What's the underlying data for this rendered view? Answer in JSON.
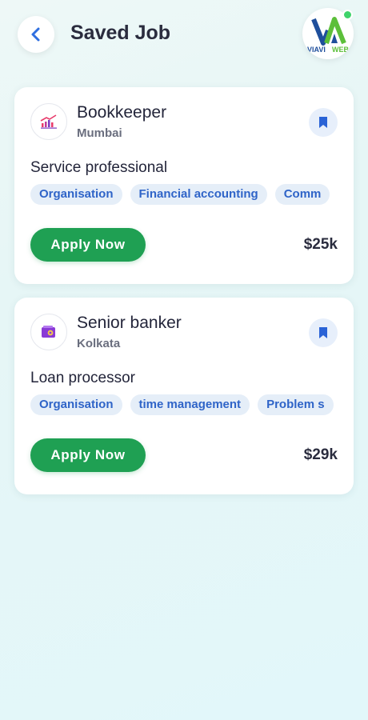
{
  "header": {
    "title": "Saved Job",
    "back_icon": "chevron-left-icon",
    "logo_text": {
      "part1": "VIAVI",
      "part2": "WEB"
    }
  },
  "colors": {
    "accent_blue": "#2f64c8",
    "apply_green": "#1fa053",
    "tag_bg": "#e5eef8"
  },
  "jobs": [
    {
      "title": "Bookkeeper",
      "location": "Mumbai",
      "role": "Service professional",
      "company_icon": "chart-logo-icon",
      "bookmark_icon": "bookmark-icon",
      "tags": [
        "Organisation",
        "Financial accounting",
        "Comm"
      ],
      "apply_label": "Apply Now",
      "salary": "$25k"
    },
    {
      "title": "Senior banker",
      "location": "Kolkata",
      "role": "Loan processor",
      "company_icon": "wallet-logo-icon",
      "bookmark_icon": "bookmark-icon",
      "tags": [
        "Organisation",
        "time management",
        "Problem s"
      ],
      "apply_label": "Apply Now",
      "salary": "$29k"
    }
  ]
}
